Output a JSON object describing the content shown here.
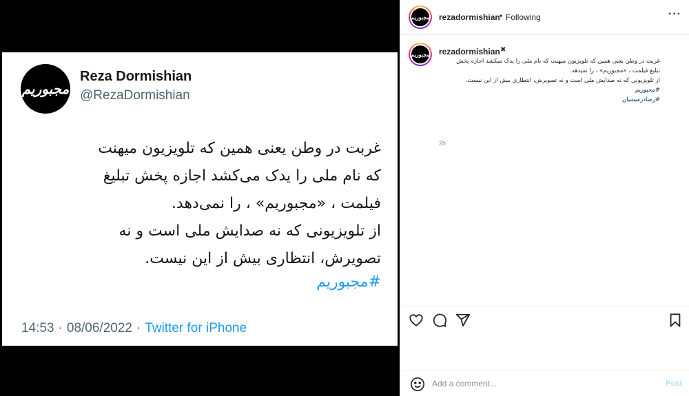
{
  "tweet": {
    "avatar_text": "مجبوریم",
    "name": "Reza Dormishian",
    "handle": "@RezaDormishian",
    "lines": [
      "غربت در وطن یعنی همین که تلویزیون میهنت",
      "که نام ملی را یدک می‌کشد اجازه پخش تبلیغ",
      "فیلمت ، «مجبوریم» ، را نمی‌دهد.",
      "از تلویزیونی که نه صدایش ملی است و نه",
      "تصویرش، انتظاری بیش از این نیست."
    ],
    "hashtag": "#مجبوریم",
    "time": "14:53",
    "date": "08/06/2022",
    "source": "Twitter for iPhone"
  },
  "header": {
    "avatar_text": "مجبوریم",
    "username": "rezadormishian",
    "dot": "•",
    "follow_status": "Following",
    "more": "···"
  },
  "caption": {
    "avatar_text": "مجبوریم",
    "username": "rezadormishian",
    "verified_glyph": "✖",
    "lines": [
      "غربت در وطن یعنی همین که تلویزیون میهنت که نام ملی را یدک میکشد اجازه پخش",
      "تبلیغ فیلمت ، «مجبوریم» ، را نمیدهد.",
      "از تلویزیونی که نه صدایش ملی است و نه تصویرش، انتظاری بیش از این نیست."
    ],
    "tags": [
      "#مجبوریم",
      "#رضادرمیشیان"
    ],
    "time_ago": "2h"
  },
  "actions": {
    "icons": [
      "heart-icon",
      "comment-icon",
      "share-icon",
      "bookmark-icon"
    ]
  },
  "comment_box": {
    "placeholder": "Add a comment...",
    "post_label": "Post"
  },
  "colors": {
    "twitter_blue": "#1d9bf0",
    "ig_link": "#00376b",
    "ig_post_disabled": "#b2dffc",
    "media_bg": "#000000"
  }
}
